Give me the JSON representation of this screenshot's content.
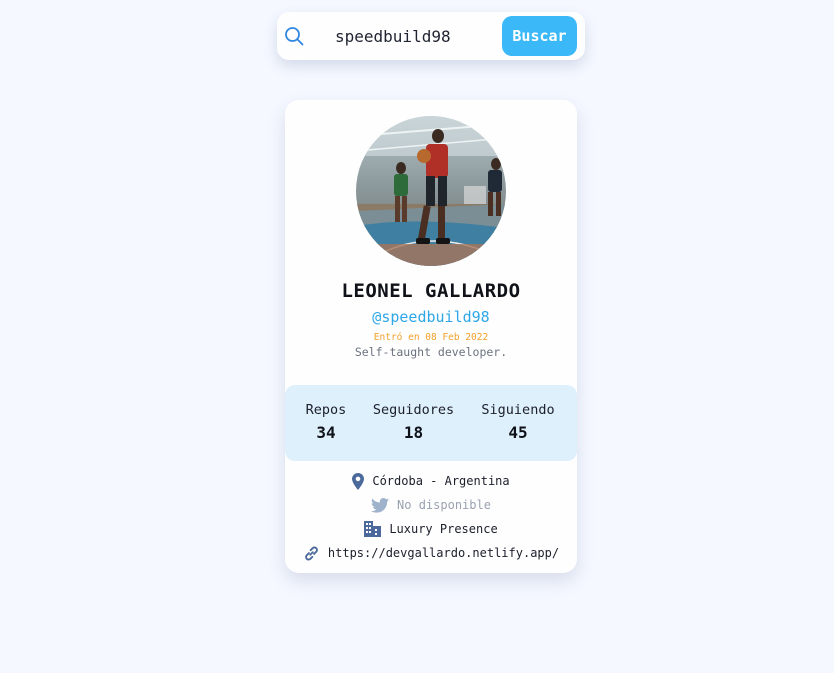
{
  "search": {
    "value": "speedbuild98",
    "button_label": "Buscar"
  },
  "profile": {
    "name": "LEONEL GALLARDO",
    "login": "@speedbuild98",
    "joined": "Entró en 08 Feb 2022",
    "bio": "Self-taught developer."
  },
  "stats": {
    "repos_label": "Repos",
    "repos_value": "34",
    "followers_label": "Seguidores",
    "followers_value": "18",
    "following_label": "Siguiendo",
    "following_value": "45"
  },
  "info": {
    "location": "Córdoba - Argentina",
    "twitter": "No disponible",
    "company": "Luxury Presence",
    "blog": "https://devgallardo.netlify.app/"
  },
  "icons": {
    "search": "search-icon",
    "location": "map-pin-icon",
    "twitter": "twitter-icon",
    "company": "building-icon",
    "blog": "link-icon"
  },
  "colors": {
    "accent": "#3bb8f8",
    "login": "#2ea7e8",
    "joined": "#f2a12a",
    "stats_bg": "#dff0fd",
    "icon": "#4b6a9b"
  }
}
